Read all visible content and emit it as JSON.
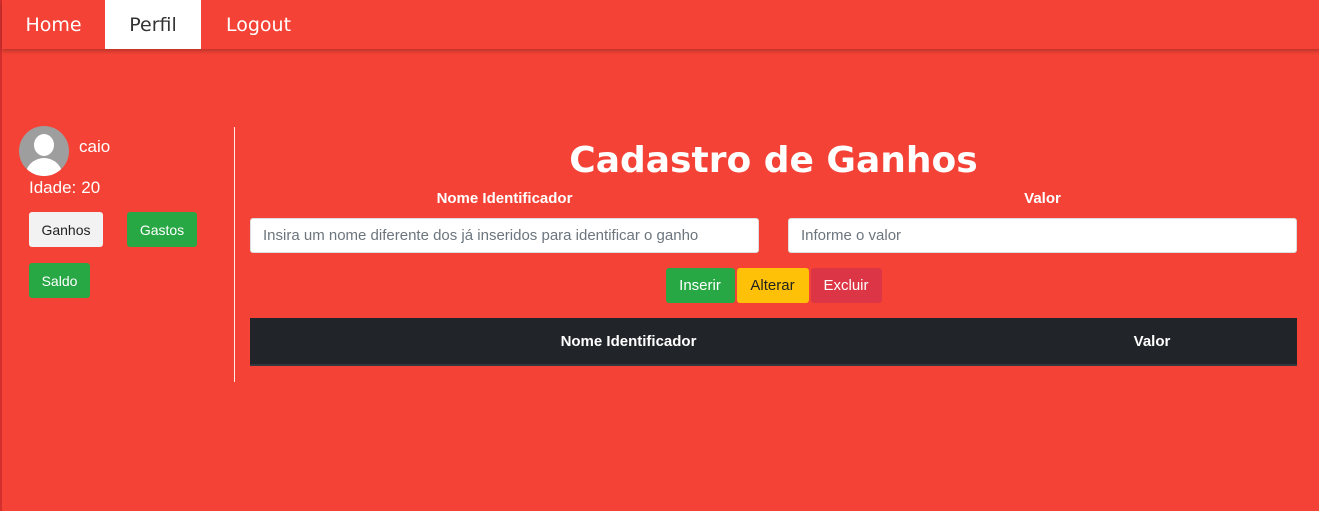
{
  "nav": {
    "items": [
      {
        "label": "Home"
      },
      {
        "label": "Perfil"
      },
      {
        "label": "Logout"
      }
    ],
    "active": "Perfil"
  },
  "sidebar": {
    "username": "caio",
    "age_label": "Idade:",
    "age_value": "20",
    "buttons": {
      "ganhos": "Ganhos",
      "gastos": "Gastos",
      "saldo": "Saldo"
    }
  },
  "main": {
    "title": "Cadastro de Ganhos",
    "fields": {
      "nome": {
        "label": "Nome Identificador",
        "placeholder": "Insira um nome diferente dos já inseridos para identificar o ganho",
        "value": ""
      },
      "valor": {
        "label": "Valor",
        "placeholder": "Informe o valor",
        "value": ""
      }
    },
    "actions": {
      "inserir": "Inserir",
      "alterar": "Alterar",
      "excluir": "Excluir"
    },
    "table": {
      "columns": [
        "Nome Identificador",
        "Valor"
      ],
      "rows": []
    }
  },
  "colors": {
    "background": "#f44336",
    "success": "#28a745",
    "warning": "#ffc107",
    "danger": "#dc3545",
    "table_header": "#212529"
  },
  "icons": {
    "avatar": "user-avatar-icon"
  }
}
